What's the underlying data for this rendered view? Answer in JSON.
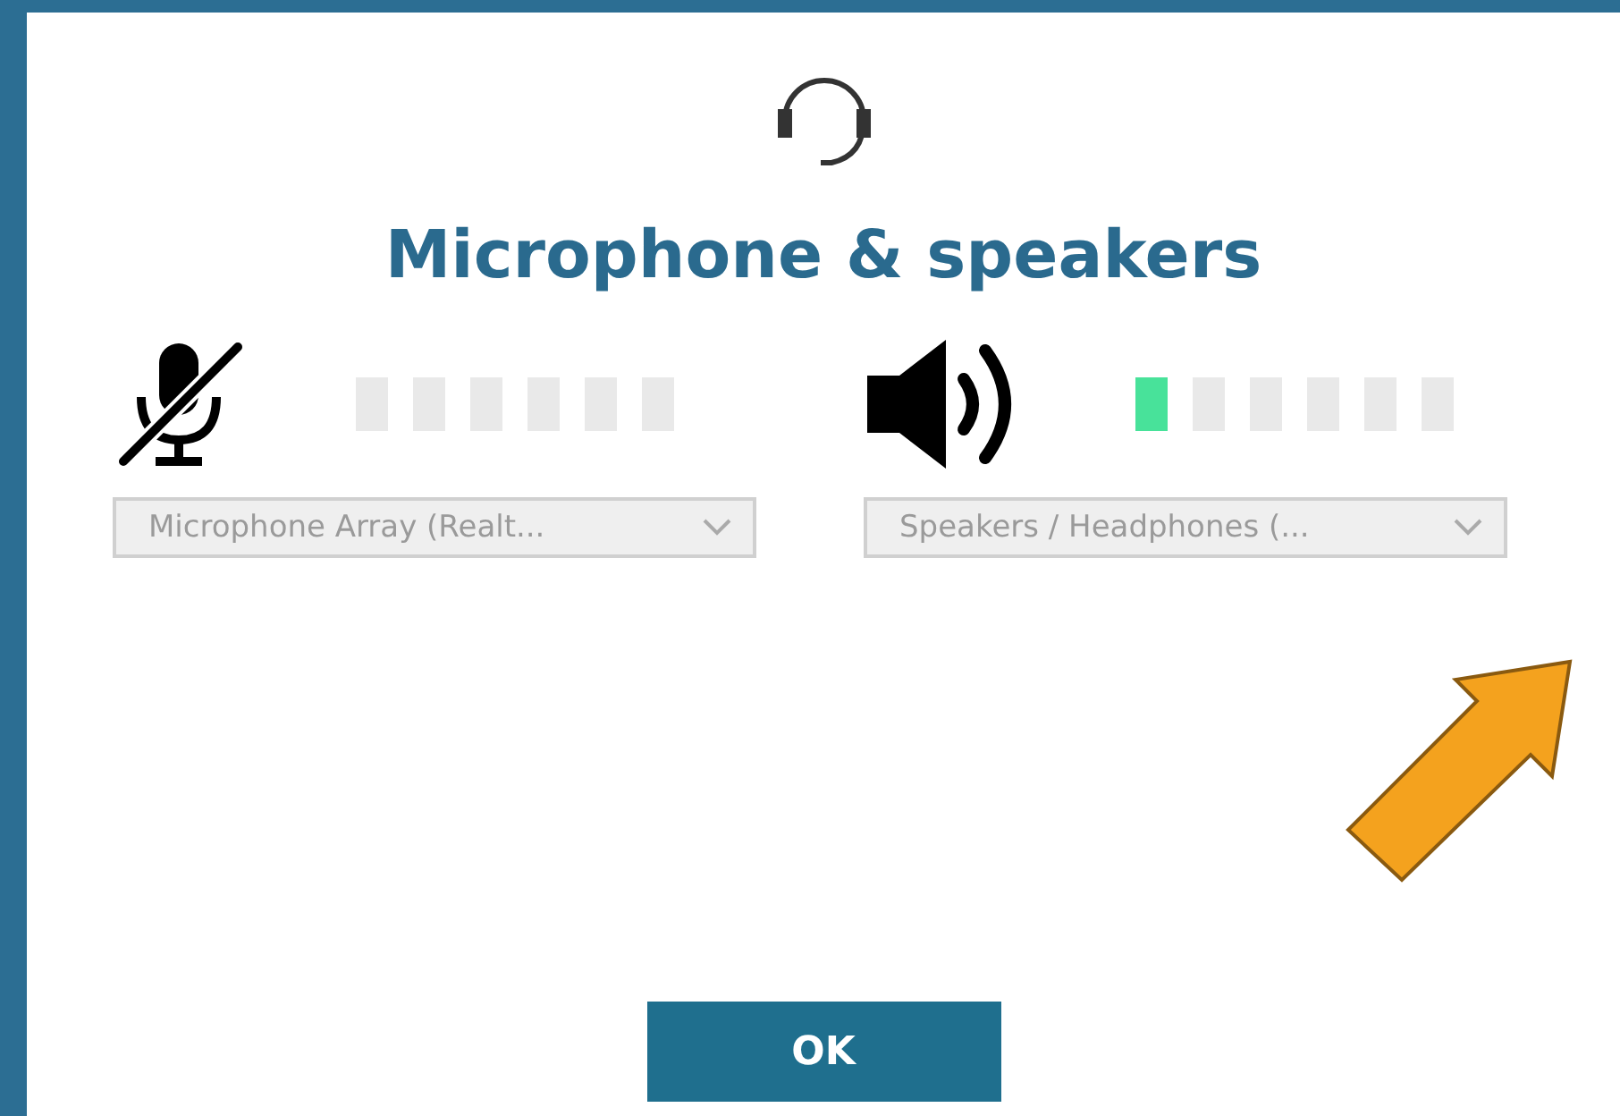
{
  "dialog": {
    "title": "Microphone & speakers"
  },
  "devices": [
    {
      "kind": "microphone",
      "muted": true,
      "segments": [
        {
          "on": false
        },
        {
          "on": false
        },
        {
          "on": false
        },
        {
          "on": false
        },
        {
          "on": false
        },
        {
          "on": false
        }
      ],
      "selection": "Microphone Array (Realt..."
    },
    {
      "kind": "speaker",
      "muted": false,
      "segments": [
        {
          "on": true
        },
        {
          "on": false
        },
        {
          "on": false
        },
        {
          "on": false
        },
        {
          "on": false
        },
        {
          "on": false
        }
      ],
      "selection": "Speakers / Headphones (..."
    }
  ],
  "buttons": [
    {
      "label": "OK"
    }
  ]
}
